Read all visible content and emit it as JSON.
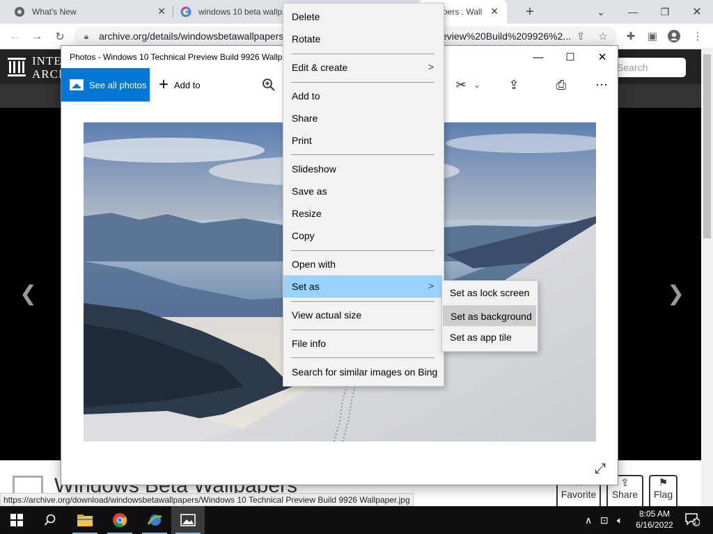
{
  "browser": {
    "tabs": [
      {
        "title": "What's New"
      },
      {
        "title": "windows 10 beta wallpa"
      },
      {
        "title": "pers : Wall"
      }
    ],
    "new_tab": "+",
    "url_left": "archive.org/details/windowsbetawallpapers",
    "url_right": "eview%20Build%209926%2..."
  },
  "ia": {
    "logo_line1": "INTE",
    "logo_line2": "ARCH",
    "search_placeholder": "Search",
    "page_title": "Windows Beta Wallpapers",
    "actions": [
      {
        "label": "Favorite",
        "icon": "star-icon"
      },
      {
        "label": "Share",
        "icon": "share-icon"
      },
      {
        "label": "Flag",
        "icon": "flag-icon"
      }
    ],
    "status_url": "https://archive.org/download/windowsbetawallpapers/Windows 10 Technical Preview Build 9926 Wallpaper.jpg"
  },
  "photos": {
    "window_title": "Photos - Windows 10 Technical Preview Build 9926 Wallpa",
    "see_all": "See all photos",
    "add_to": "Add to"
  },
  "context_menu": {
    "items": [
      {
        "label": "Delete"
      },
      {
        "label": "Rotate"
      },
      {
        "label": "Edit & create",
        "submenu": true
      },
      {
        "label": "Add to"
      },
      {
        "label": "Share"
      },
      {
        "label": "Print"
      },
      {
        "label": "Slideshow"
      },
      {
        "label": "Save as"
      },
      {
        "label": "Resize"
      },
      {
        "label": "Copy"
      },
      {
        "label": "Open with"
      },
      {
        "label": "Set as",
        "submenu": true,
        "highlighted": true
      },
      {
        "label": "View actual size"
      },
      {
        "label": "File info"
      },
      {
        "label": "Search for similar images on Bing"
      }
    ],
    "submenu": [
      {
        "label": "Set as lock screen"
      },
      {
        "label": "Set as background",
        "highlighted": true
      },
      {
        "label": "Set as app tile"
      }
    ]
  },
  "taskbar": {
    "time": "8:05 AM",
    "date": "6/16/2022",
    "notifications": "1"
  },
  "colors": {
    "accent": "#0078d7",
    "menu_highlight": "#99d1ff",
    "submenu_highlight": "#cdcdcd"
  }
}
